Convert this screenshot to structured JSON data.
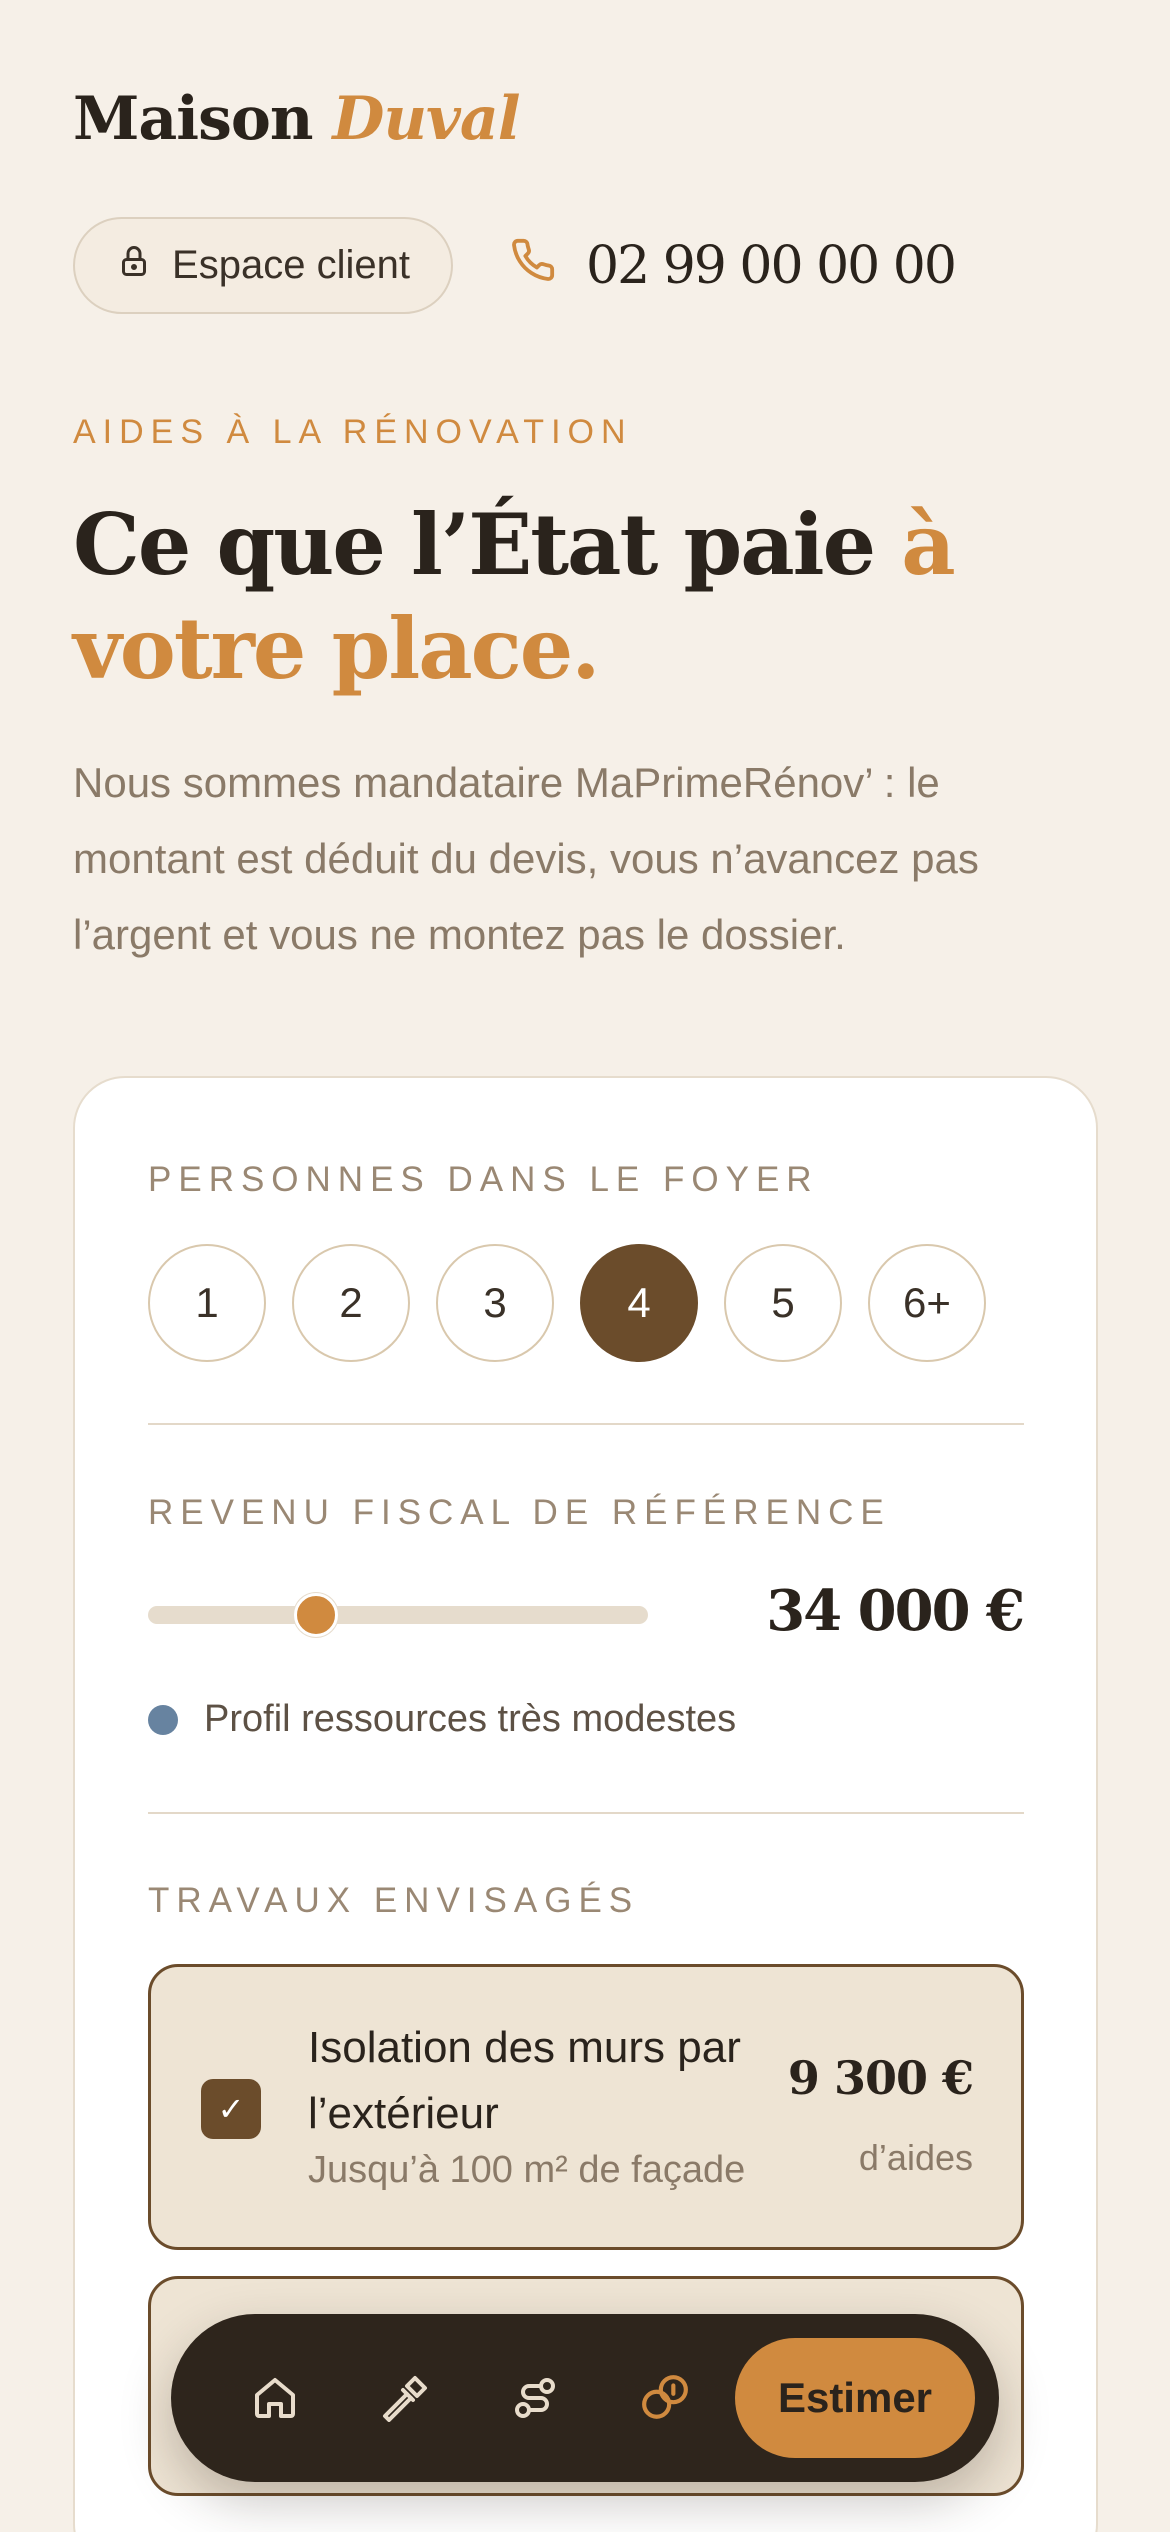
{
  "brand": {
    "name": "Maison",
    "accent": "Duval"
  },
  "header": {
    "client_label": "Espace client",
    "phone": "02 99 00 00 00"
  },
  "hero": {
    "eyebrow": "AIDES À LA RÉNOVATION",
    "title_main": "Ce que l’État paie ",
    "title_accent": "à votre place.",
    "text": "Nous sommes mandataire MaPrimeRénov’ : le montant est déduit du devis, vous n’avancez pas l’argent et vous ne montez pas le dossier."
  },
  "household": {
    "label": "PERSONNES DANS LE FOYER",
    "options": [
      "1",
      "2",
      "3",
      "4",
      "5",
      "6+"
    ],
    "selected": "4"
  },
  "income": {
    "label": "REVENU FISCAL DE RÉFÉRENCE",
    "value": "34 000 €",
    "slider_fraction": 0.335,
    "profile": "Profil ressources très modestes",
    "profile_color": "#6783a0"
  },
  "works": {
    "label": "TRAVAUX ENVISAGÉS",
    "items": [
      {
        "title": "Isolation des murs par l’extérieur",
        "subtitle": "Jusqu’à 100 m² de façade",
        "amount": "9 300 €",
        "amount_label": "d’aides",
        "checked": true
      }
    ]
  },
  "nav": {
    "icons": [
      "home-icon",
      "hammer-icon",
      "route-icon",
      "coins-icon"
    ],
    "active": "coins-icon",
    "cta": "Estimer"
  },
  "colors": {
    "accent": "#d08a3f",
    "brown": "#6b4c2b",
    "background": "#f6f0e8"
  }
}
